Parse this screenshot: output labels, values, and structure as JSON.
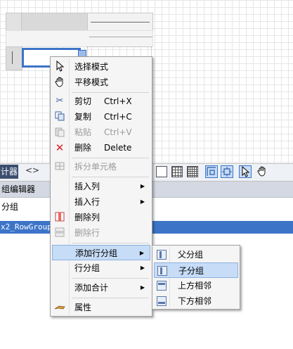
{
  "toolbar": {
    "designer_tab": "计器",
    "code_icon": "<>",
    "icons": [
      "box-icon",
      "grid-small-icon",
      "grid-large-icon",
      "snap-lines-icon",
      "snap-grid-icon",
      "pointer-icon",
      "hand-icon"
    ]
  },
  "panel": {
    "header": "组编辑器",
    "sub_label": "分组",
    "group_row": "x2_RowGroup1"
  },
  "context_menu": {
    "items": [
      {
        "icon": "pointer-icon",
        "label": "选择模式",
        "shortcut": "",
        "disabled": false,
        "submenu": false
      },
      {
        "icon": "hand-icon",
        "label": "平移模式",
        "shortcut": "",
        "disabled": false,
        "submenu": false
      },
      {
        "icon": "scissors-icon",
        "label": "剪切",
        "shortcut": "Ctrl+X",
        "disabled": false,
        "submenu": false
      },
      {
        "icon": "copy-icon",
        "label": "复制",
        "shortcut": "Ctrl+C",
        "disabled": false,
        "submenu": false
      },
      {
        "icon": "paste-icon",
        "label": "粘贴",
        "shortcut": "Ctrl+V",
        "disabled": true,
        "submenu": false
      },
      {
        "icon": "delete-x-icon",
        "label": "删除",
        "shortcut": "Delete",
        "disabled": false,
        "submenu": false
      },
      {
        "icon": "split-cells-icon",
        "label": "拆分单元格",
        "shortcut": "",
        "disabled": true,
        "submenu": false
      },
      {
        "icon": "",
        "label": "插入列",
        "shortcut": "",
        "disabled": false,
        "submenu": true
      },
      {
        "icon": "",
        "label": "插入行",
        "shortcut": "",
        "disabled": false,
        "submenu": true
      },
      {
        "icon": "delete-column-icon",
        "label": "删除列",
        "shortcut": "",
        "disabled": false,
        "submenu": false
      },
      {
        "icon": "delete-row-icon",
        "label": "删除行",
        "shortcut": "",
        "disabled": true,
        "submenu": false
      },
      {
        "icon": "",
        "label": "添加行分组",
        "shortcut": "",
        "disabled": false,
        "submenu": true,
        "highlighted": true
      },
      {
        "icon": "",
        "label": "行分组",
        "shortcut": "",
        "disabled": false,
        "submenu": true
      },
      {
        "icon": "",
        "label": "添加合计",
        "shortcut": "",
        "disabled": false,
        "submenu": true
      },
      {
        "icon": "properties-icon",
        "label": "属性",
        "shortcut": "",
        "disabled": false,
        "submenu": false
      }
    ]
  },
  "sub_menu": {
    "items": [
      {
        "icon": "parent-group-icon",
        "label": "父分组"
      },
      {
        "icon": "child-group-icon",
        "label": "子分组",
        "highlighted": true
      },
      {
        "icon": "adjacent-above-icon",
        "label": "上方相邻"
      },
      {
        "icon": "adjacent-below-icon",
        "label": "下方相邻"
      }
    ]
  },
  "colors": {
    "selection_blue": "#3c74c8",
    "menu_highlight": "#c6dcf7",
    "delete_red": "#e02020"
  }
}
